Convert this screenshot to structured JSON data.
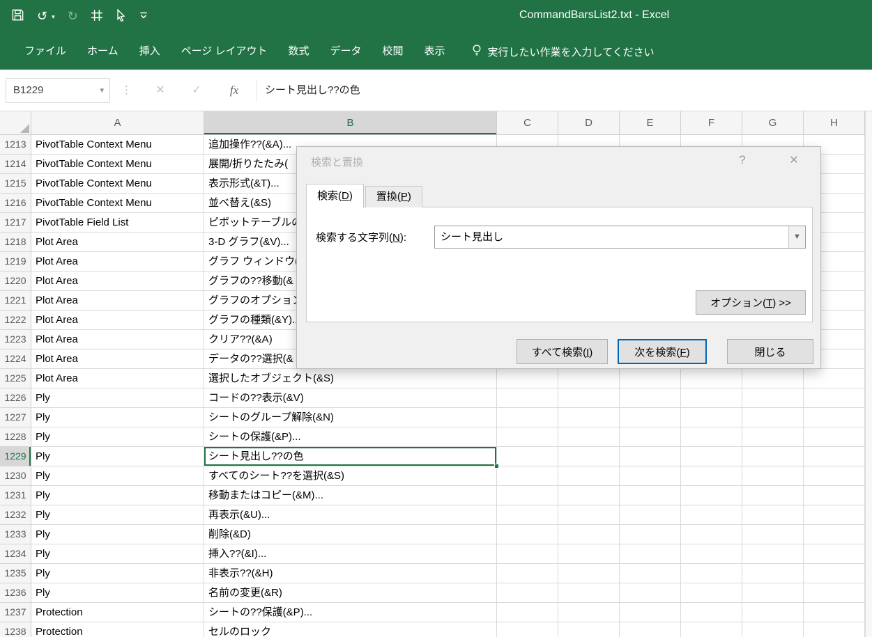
{
  "colors": {
    "accent_green": "#217346",
    "focus_blue": "#0067b8",
    "gridline": "#d9d9d9"
  },
  "title_bar": {
    "title": "CommandBarsList2.txt  -  Excel"
  },
  "ribbon": {
    "tabs": [
      "ファイル",
      "ホーム",
      "挿入",
      "ページ レイアウト",
      "数式",
      "データ",
      "校閲",
      "表示"
    ],
    "tell_me": "実行したい作業を入力してください"
  },
  "formula_bar": {
    "name_box": "B1229",
    "formula": "シート見出し??の色"
  },
  "icons": {
    "undo": "↺",
    "redo": "↻",
    "cancel": "✕",
    "enter": "✓",
    "fx": "fx",
    "name_box_arrow": "▾",
    "handle": "⋮",
    "dialog_help": "?",
    "dialog_close": "✕",
    "combo_arrow": "▼"
  },
  "grid": {
    "columns": [
      "A",
      "B",
      "C",
      "D",
      "E",
      "F",
      "G",
      "H"
    ],
    "active": {
      "row": "1229",
      "col": "B"
    },
    "rows": [
      {
        "n": "1213",
        "a": "PivotTable Context Menu",
        "b": "追加操作??(&A)..."
      },
      {
        "n": "1214",
        "a": "PivotTable Context Menu",
        "b": "展開/折りたたみ("
      },
      {
        "n": "1215",
        "a": "PivotTable Context Menu",
        "b": "表示形式(&T)..."
      },
      {
        "n": "1216",
        "a": "PivotTable Context Menu",
        "b": "並べ替え(&S)"
      },
      {
        "n": "1217",
        "a": "PivotTable Field List",
        "b": "ピボットテーブルのフ"
      },
      {
        "n": "1218",
        "a": "Plot Area",
        "b": "3-D グラフ(&V)..."
      },
      {
        "n": "1219",
        "a": "Plot Area",
        "b": "グラフ ウィンドウ(&"
      },
      {
        "n": "1220",
        "a": "Plot Area",
        "b": "グラフの??移動(&"
      },
      {
        "n": "1221",
        "a": "Plot Area",
        "b": "グラフのオプション("
      },
      {
        "n": "1222",
        "a": "Plot Area",
        "b": "グラフの種類(&Y)..."
      },
      {
        "n": "1223",
        "a": "Plot Area",
        "b": "クリア??(&A)"
      },
      {
        "n": "1224",
        "a": "Plot Area",
        "b": "データの??選択(&"
      },
      {
        "n": "1225",
        "a": "Plot Area",
        "b": "選択したオブジェクト(&S)"
      },
      {
        "n": "1226",
        "a": "Ply",
        "b": "コードの??表示(&V)"
      },
      {
        "n": "1227",
        "a": "Ply",
        "b": "シートのグループ解除(&N)"
      },
      {
        "n": "1228",
        "a": "Ply",
        "b": "シートの保護(&P)..."
      },
      {
        "n": "1229",
        "a": "Ply",
        "b": "シート見出し??の色"
      },
      {
        "n": "1230",
        "a": "Ply",
        "b": "すべてのシート??を選択(&S)"
      },
      {
        "n": "1231",
        "a": "Ply",
        "b": "移動またはコピー(&M)..."
      },
      {
        "n": "1232",
        "a": "Ply",
        "b": "再表示(&U)..."
      },
      {
        "n": "1233",
        "a": "Ply",
        "b": "削除(&D)"
      },
      {
        "n": "1234",
        "a": "Ply",
        "b": "挿入??(&I)..."
      },
      {
        "n": "1235",
        "a": "Ply",
        "b": "非表示??(&H)"
      },
      {
        "n": "1236",
        "a": "Ply",
        "b": "名前の変更(&R)"
      },
      {
        "n": "1237",
        "a": "Protection",
        "b": "シートの??保護(&P)..."
      },
      {
        "n": "1238",
        "a": "Protection",
        "b": "セルのロック"
      }
    ]
  },
  "dialog": {
    "title": "検索と置換",
    "tabs": [
      "検索(D)",
      "置換(P)"
    ],
    "search_label": "検索する文字列(N):",
    "search_value": "シート見出し",
    "options_label": "オプション(T) >>",
    "find_all_label": "すべて検索(I)",
    "find_next_label": "次を検索(F)",
    "close_label": "閉じる"
  }
}
